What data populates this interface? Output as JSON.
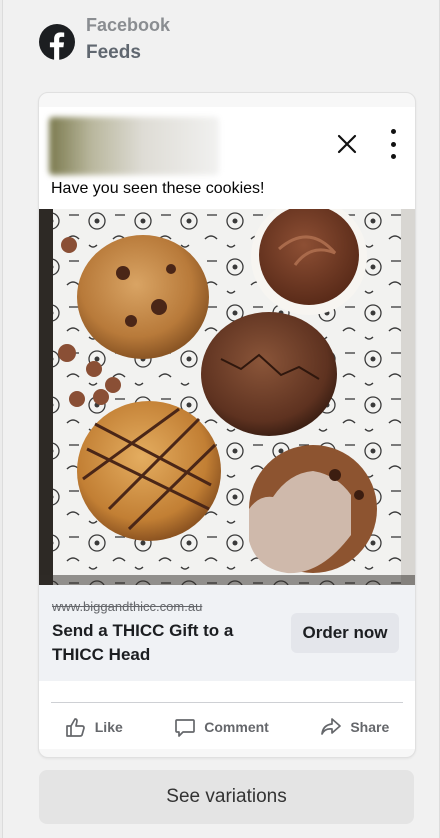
{
  "header": {
    "brand": "Facebook",
    "placement": "Feeds"
  },
  "post": {
    "text": "Have you seen these cookies!",
    "image_alt": "cookies"
  },
  "cta": {
    "url": "www.biggandthicc.com.au",
    "headline": "Send a THICC Gift to a THICC Head",
    "button_label": "Order now"
  },
  "actions": {
    "like": "Like",
    "comment": "Comment",
    "share": "Share"
  },
  "footer": {
    "see_variations": "See variations"
  },
  "colors": {
    "facebook_logo": "#1c1e21",
    "cta_button_bg": "#e4e6eb",
    "cta_bar_bg": "#f0f2f5",
    "action_text": "#65676b"
  },
  "icons": {
    "brand": "facebook-logo-icon",
    "close": "close-icon",
    "more": "more-options-icon",
    "like": "thumbs-up-icon",
    "comment": "comment-bubble-icon",
    "share": "share-arrow-icon"
  }
}
